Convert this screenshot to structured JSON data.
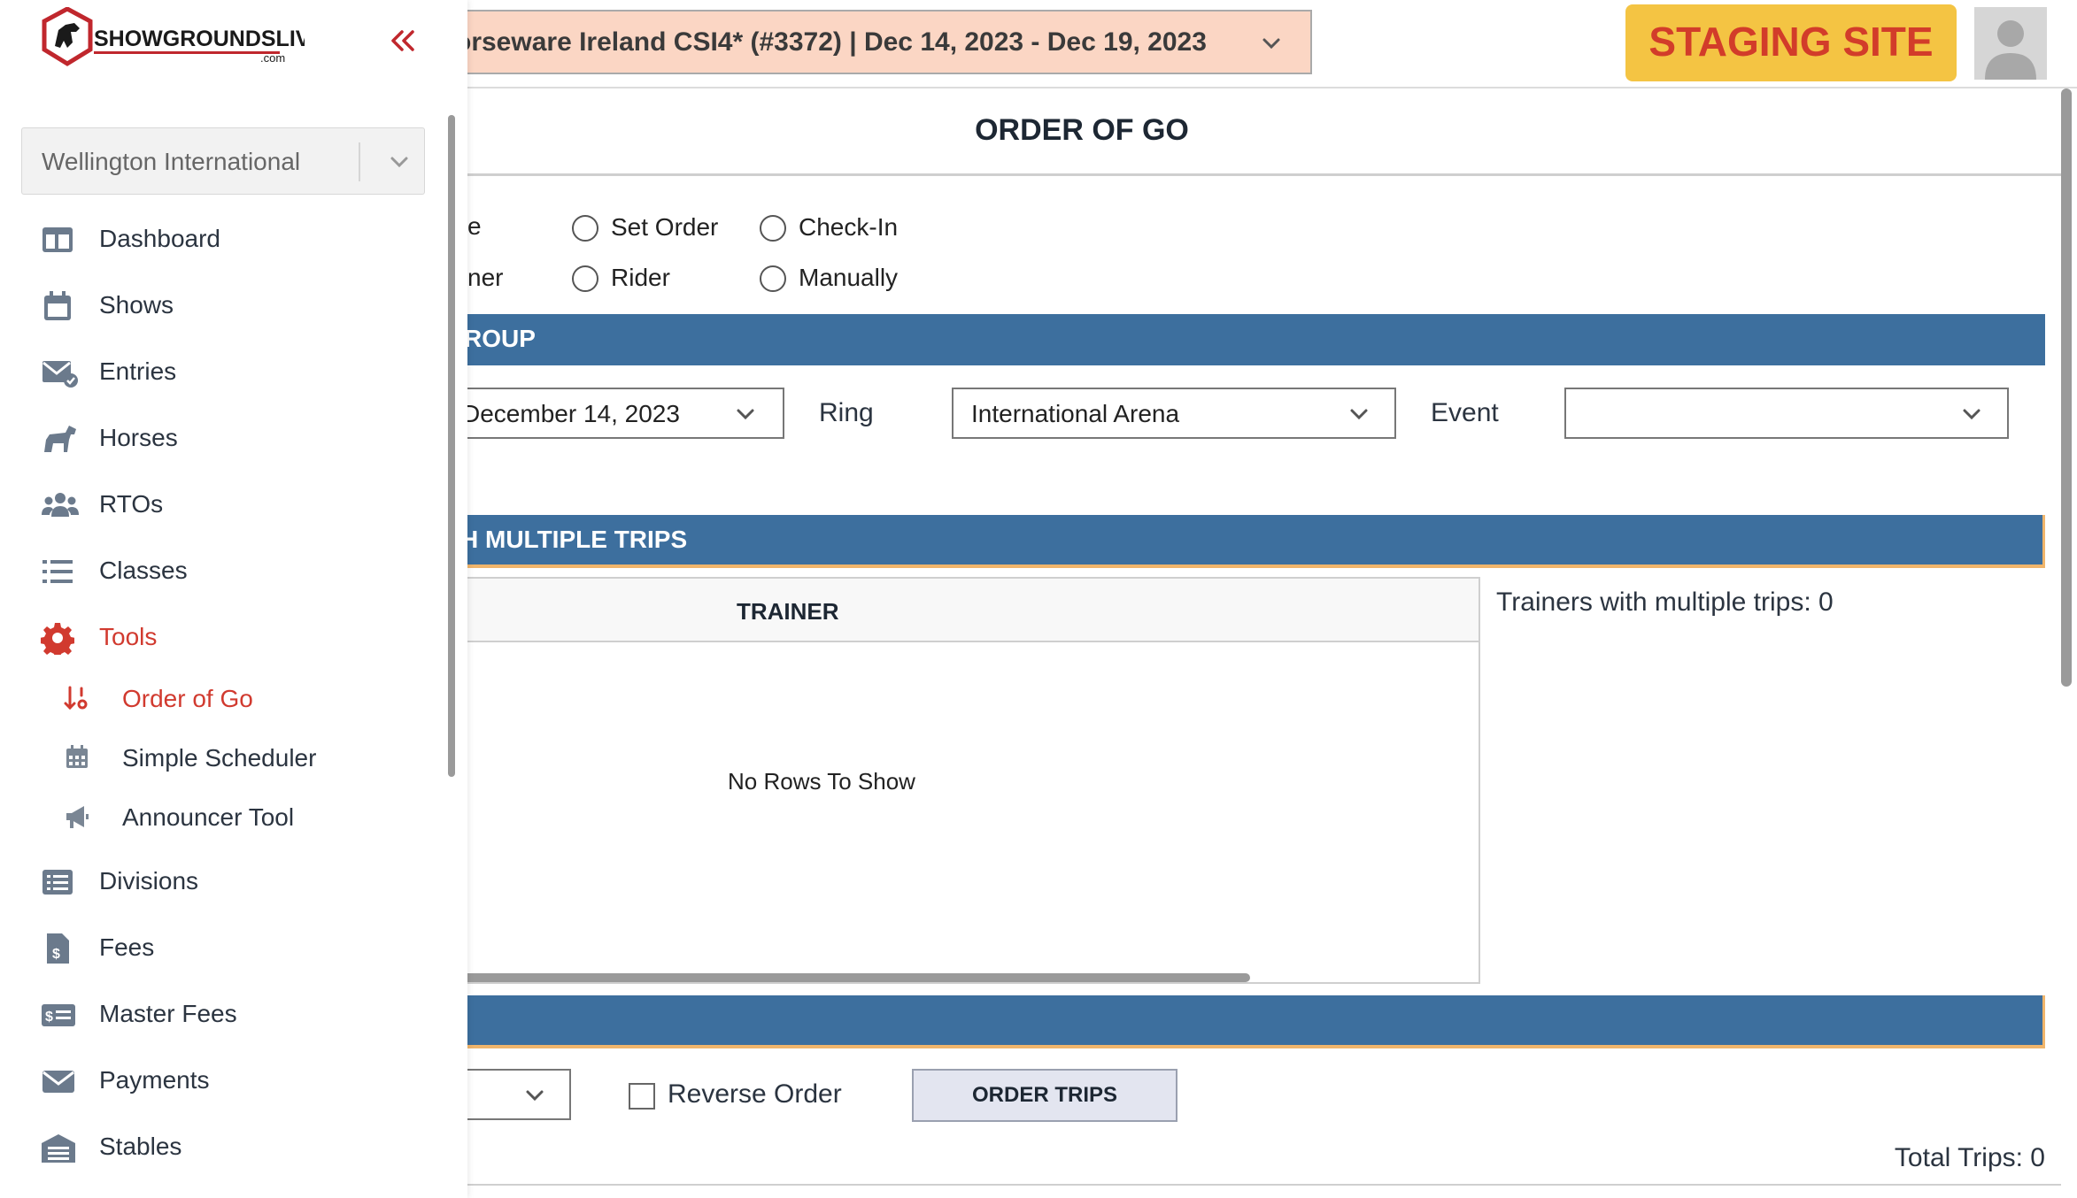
{
  "brand": {
    "name": "SHOWGROUNDSLIVE",
    "tld": ".com",
    "accent": "#c0272d"
  },
  "sidebar": {
    "company": "Wellington International",
    "items": [
      {
        "label": "Dashboard",
        "icon": "dashboard-icon"
      },
      {
        "label": "Shows",
        "icon": "calendar-icon"
      },
      {
        "label": "Entries",
        "icon": "mail-check-icon"
      },
      {
        "label": "Horses",
        "icon": "horse-icon"
      },
      {
        "label": "RTOs",
        "icon": "people-icon"
      },
      {
        "label": "Classes",
        "icon": "list-icon"
      },
      {
        "label": "Tools",
        "icon": "gear-icon",
        "active": true
      },
      {
        "label": "Divisions",
        "icon": "list-box-icon"
      },
      {
        "label": "Fees",
        "icon": "invoice-icon"
      },
      {
        "label": "Master Fees",
        "icon": "money-card-icon"
      },
      {
        "label": "Payments",
        "icon": "envelope-icon"
      },
      {
        "label": "Stables",
        "icon": "warehouse-icon"
      }
    ],
    "sub_items": [
      {
        "label": "Order of Go",
        "icon": "sort-icon",
        "active": true
      },
      {
        "label": "Simple Scheduler",
        "icon": "calendar-grid-icon"
      },
      {
        "label": "Announcer Tool",
        "icon": "megaphone-icon"
      }
    ]
  },
  "header": {
    "show": "orseware Ireland CSI4* (#3372) | Dec 14, 2023 - Dec 19, 2023",
    "staging": "STAGING SITE"
  },
  "page": {
    "title": "ORDER OF GO",
    "partial_radio_1": "e",
    "partial_radio_2": "ner",
    "radios": [
      {
        "label": "Set Order"
      },
      {
        "label": "Check-In"
      },
      {
        "label": "Rider"
      },
      {
        "label": "Manually"
      }
    ],
    "group_band": "ROUP",
    "date_value": "December 14, 2023",
    "ring_label": "Ring",
    "ring_value": "International Arena",
    "event_label": "Event",
    "event_value": "",
    "trips_band": "H MULTIPLE TRIPS",
    "grid": {
      "column": "TRAINER",
      "empty": "No Rows To Show"
    },
    "trainers_count": "Trainers with multiple trips: 0",
    "reverse_label": "Reverse Order",
    "order_button": "ORDER TRIPS",
    "total_trips": "Total Trips: 0"
  }
}
